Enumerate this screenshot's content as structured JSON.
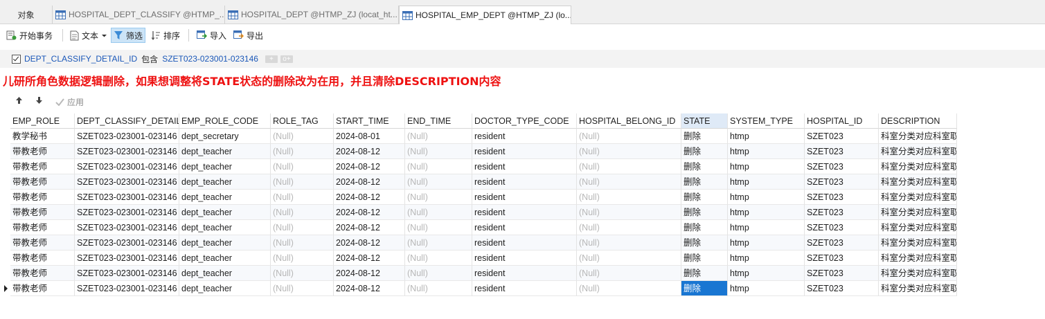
{
  "tabs": [
    {
      "label": "对象",
      "active": false
    },
    {
      "label": "HOSPITAL_DEPT_CLASSIFY @HTMP_...",
      "active": false
    },
    {
      "label": "HOSPITAL_DEPT @HTMP_ZJ (locat_ht...",
      "active": false
    },
    {
      "label": "HOSPITAL_EMP_DEPT @HTMP_ZJ (lo...",
      "active": true
    }
  ],
  "toolbar": {
    "begin_tx": "开始事务",
    "text": "文本",
    "filter": "筛选",
    "sort": "排序",
    "import": "导入",
    "export": "导出"
  },
  "filter": {
    "field": "DEPT_CLASSIFY_DETAIL_ID",
    "op": "包含",
    "value": "SZET023-023001-023146",
    "add_btn": "+",
    "add_group_btn": "o+"
  },
  "annotation": "儿研所角色数据逻辑删除，如果想调整将STATE状态的删除改为在用，并且清除DESCRIPTION内容",
  "apply_label": "应用",
  "colors": {
    "accent": "#1976d2",
    "annotation": "#ee1111",
    "link": "#1a57b8"
  },
  "columns": [
    "EMP_ROLE",
    "DEPT_CLASSIFY_DETAIL_ID",
    "EMP_ROLE_CODE",
    "ROLE_TAG",
    "START_TIME",
    "END_TIME",
    "DOCTOR_TYPE_CODE",
    "HOSPITAL_BELONG_ID",
    "STATE",
    "SYSTEM_TYPE",
    "HOSPITAL_ID",
    "DESCRIPTION"
  ],
  "rows": [
    [
      "教学秘书",
      "SZET023-023001-023146",
      "dept_secretary",
      "(Null)",
      "2024-08-01",
      "(Null)",
      "resident",
      "(Null)",
      "删除",
      "htmp",
      "SZET023",
      "科室分类对应科室取"
    ],
    [
      "带教老师",
      "SZET023-023001-023146",
      "dept_teacher",
      "(Null)",
      "2024-08-12",
      "(Null)",
      "resident",
      "(Null)",
      "删除",
      "htmp",
      "SZET023",
      "科室分类对应科室取"
    ],
    [
      "带教老师",
      "SZET023-023001-023146",
      "dept_teacher",
      "(Null)",
      "2024-08-12",
      "(Null)",
      "resident",
      "(Null)",
      "删除",
      "htmp",
      "SZET023",
      "科室分类对应科室取"
    ],
    [
      "带教老师",
      "SZET023-023001-023146",
      "dept_teacher",
      "(Null)",
      "2024-08-12",
      "(Null)",
      "resident",
      "(Null)",
      "删除",
      "htmp",
      "SZET023",
      "科室分类对应科室取"
    ],
    [
      "带教老师",
      "SZET023-023001-023146",
      "dept_teacher",
      "(Null)",
      "2024-08-12",
      "(Null)",
      "resident",
      "(Null)",
      "删除",
      "htmp",
      "SZET023",
      "科室分类对应科室取"
    ],
    [
      "带教老师",
      "SZET023-023001-023146",
      "dept_teacher",
      "(Null)",
      "2024-08-12",
      "(Null)",
      "resident",
      "(Null)",
      "删除",
      "htmp",
      "SZET023",
      "科室分类对应科室取"
    ],
    [
      "带教老师",
      "SZET023-023001-023146",
      "dept_teacher",
      "(Null)",
      "2024-08-12",
      "(Null)",
      "resident",
      "(Null)",
      "删除",
      "htmp",
      "SZET023",
      "科室分类对应科室取"
    ],
    [
      "带教老师",
      "SZET023-023001-023146",
      "dept_teacher",
      "(Null)",
      "2024-08-12",
      "(Null)",
      "resident",
      "(Null)",
      "删除",
      "htmp",
      "SZET023",
      "科室分类对应科室取"
    ],
    [
      "带教老师",
      "SZET023-023001-023146",
      "dept_teacher",
      "(Null)",
      "2024-08-12",
      "(Null)",
      "resident",
      "(Null)",
      "删除",
      "htmp",
      "SZET023",
      "科室分类对应科室取"
    ],
    [
      "带教老师",
      "SZET023-023001-023146",
      "dept_teacher",
      "(Null)",
      "2024-08-12",
      "(Null)",
      "resident",
      "(Null)",
      "删除",
      "htmp",
      "SZET023",
      "科室分类对应科室取"
    ],
    [
      "带教老师",
      "SZET023-023001-023146",
      "dept_teacher",
      "(Null)",
      "2024-08-12",
      "(Null)",
      "resident",
      "(Null)",
      "删除",
      "htmp",
      "SZET023",
      "科室分类对应科室取"
    ]
  ],
  "current_row": 10,
  "selected_column": "STATE"
}
